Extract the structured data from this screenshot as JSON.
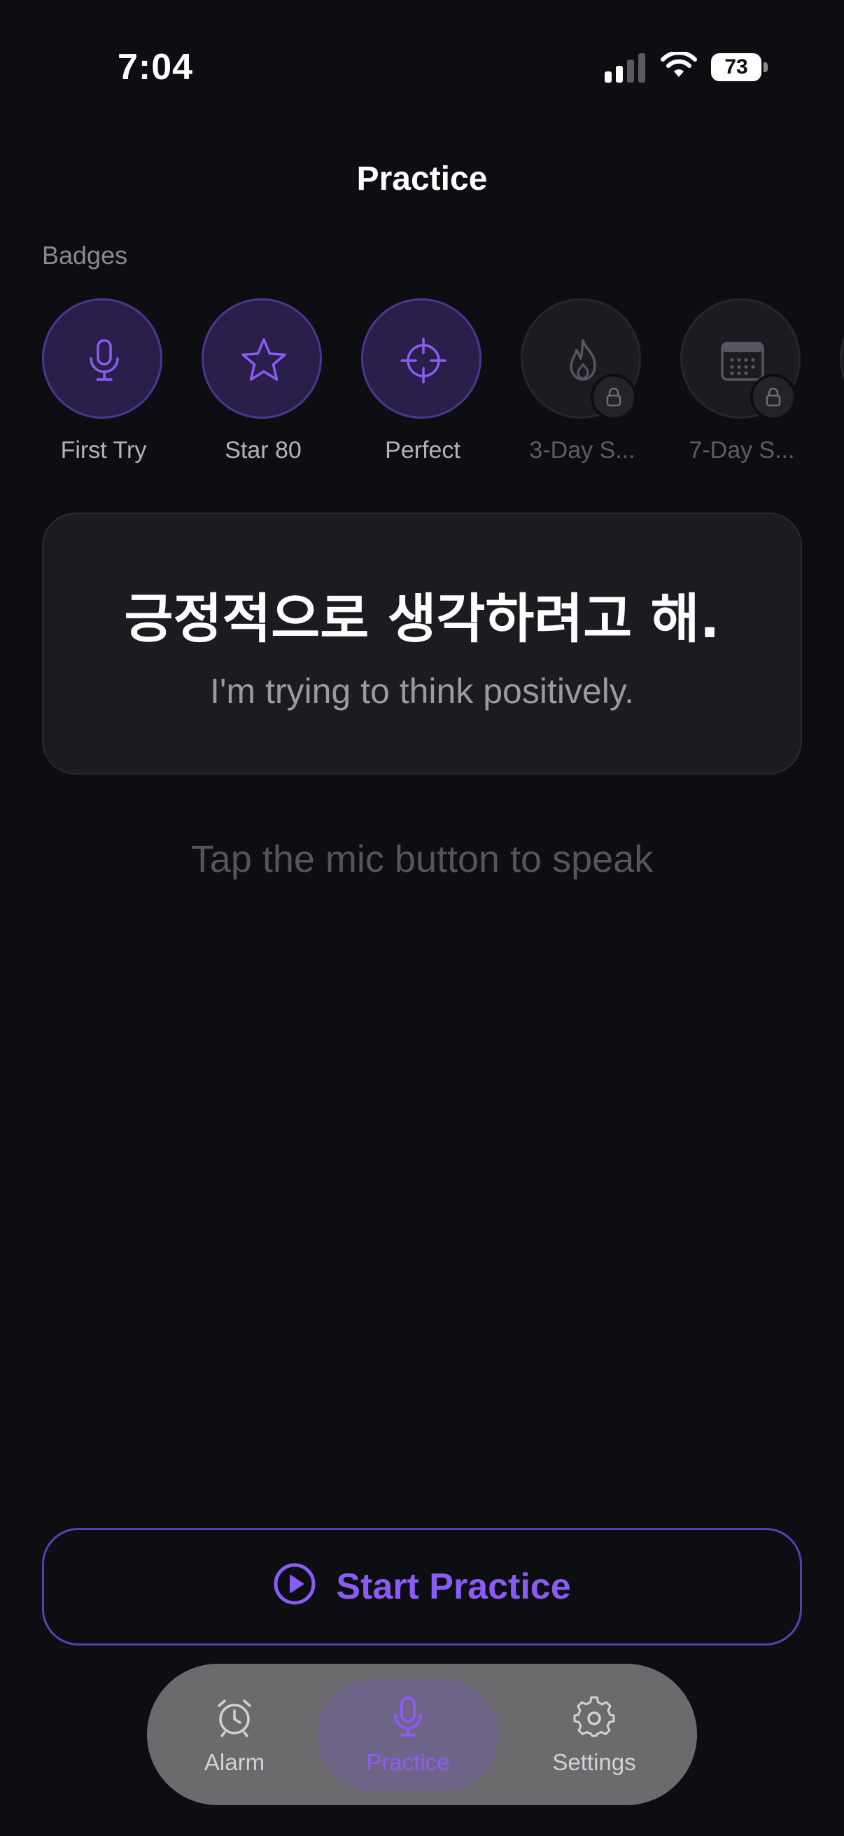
{
  "status_bar": {
    "time": "7:04",
    "battery": "73"
  },
  "header": {
    "title": "Practice"
  },
  "badges": {
    "label": "Badges",
    "items": [
      {
        "label": "First Try",
        "icon": "microphone-icon",
        "unlocked": true
      },
      {
        "label": "Star 80",
        "icon": "star-icon",
        "unlocked": true
      },
      {
        "label": "Perfect",
        "icon": "crosshair-icon",
        "unlocked": true
      },
      {
        "label": "3-Day S...",
        "icon": "flame-icon",
        "unlocked": false
      },
      {
        "label": "7-Day S...",
        "icon": "calendar-icon",
        "unlocked": false
      }
    ]
  },
  "phrase": {
    "korean": "긍정적으로 생각하려고 해.",
    "english": "I'm trying to think positively."
  },
  "hint": "Tap the mic button to speak",
  "start_button": {
    "label": "Start Practice"
  },
  "tab_bar": {
    "tabs": [
      {
        "label": "Alarm",
        "icon": "alarm-clock-icon",
        "active": false
      },
      {
        "label": "Practice",
        "icon": "microphone-icon",
        "active": true
      },
      {
        "label": "Settings",
        "icon": "gear-icon",
        "active": false
      }
    ]
  },
  "colors": {
    "background": "#0d0e12",
    "accent": "#8a5cf5",
    "card": "#1b1c20"
  }
}
